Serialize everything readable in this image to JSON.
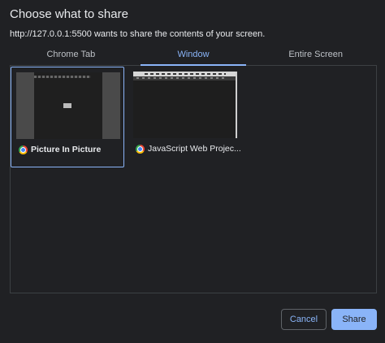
{
  "dialog": {
    "title": "Choose what to share",
    "subtitle": "http://127.0.0.1:5500 wants to share the contents of your screen."
  },
  "tabs": [
    {
      "label": "Chrome Tab",
      "active": false
    },
    {
      "label": "Window",
      "active": true
    },
    {
      "label": "Entire Screen",
      "active": false
    }
  ],
  "windows": [
    {
      "label": "Picture In Picture",
      "icon": "chrome-icon",
      "selected": true
    },
    {
      "label": "JavaScript Web Projec...",
      "icon": "chrome-icon",
      "selected": false
    }
  ],
  "buttons": {
    "cancel": "Cancel",
    "share": "Share"
  },
  "colors": {
    "accent": "#8ab4f8",
    "background": "#202124"
  }
}
